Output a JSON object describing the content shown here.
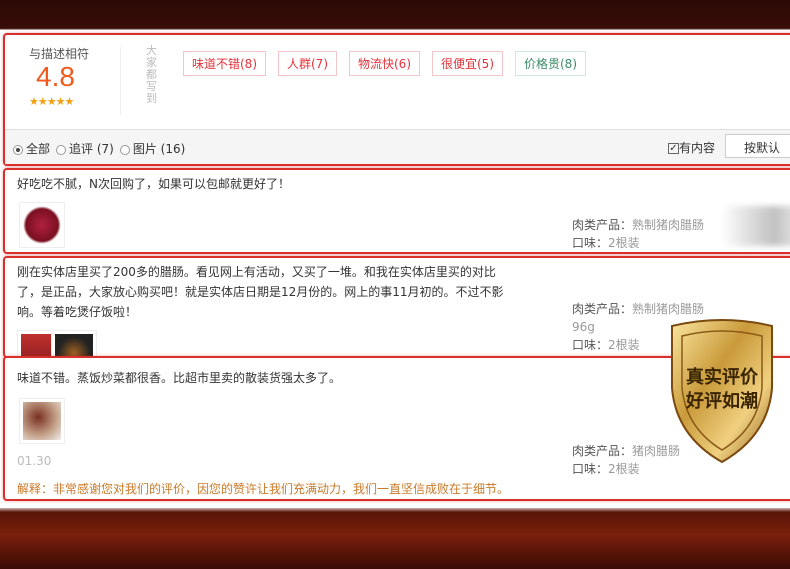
{
  "summary": {
    "score_label": "与描述相符",
    "score": "4.8",
    "stars": "★★★★★",
    "side_text": "大家都写到",
    "tags": [
      {
        "label": "味道不错(8)"
      },
      {
        "label": "人群(7)"
      },
      {
        "label": "物流快(6)"
      },
      {
        "label": "很便宜(5)"
      },
      {
        "label": "价格贵(8)"
      }
    ]
  },
  "filters": {
    "all": "全部",
    "append": "追评 (7)",
    "pictures": "图片 (16)",
    "has_content": "有内容",
    "sort": "按默认"
  },
  "reviews": [
    {
      "text": "好吃吃不腻，N次回购了，如果可以包邮就更好了！",
      "product_label": "肉类产品：",
      "product": "熟制猪肉腊肠",
      "taste_label": "口味：",
      "taste": "2根装"
    },
    {
      "text": "刚在实体店里买了200多的腊肠。看见网上有活动，又买了一堆。和我在实体店里买的对比了，是正品，大家放心购买吧！就是实体店日期是12月份的。网上的事11月初的。不过不影响。等着吃煲仔饭啦！",
      "product_label": "肉类产品：",
      "product": "熟制猪肉腊肠",
      "weight": "96g",
      "taste_label": "口味：",
      "taste": "2根装"
    },
    {
      "text": "味道不错。蒸饭炒菜都很香。比超市里卖的散装货强太多了。",
      "date": "01.30",
      "product_label": "肉类产品：",
      "product": "猪肉腊肠",
      "taste_label": "口味：",
      "taste": "2根装",
      "reply": "解释：非常感谢您对我们的评价，因您的赞许让我们充满动力，我们一直坚信成败在于细节。"
    }
  ],
  "badge": {
    "line1": "真实评价",
    "line2": "好评如潮"
  },
  "colors": {
    "accent": "#d9302c",
    "score": "#f05a1a",
    "gold": "#c99a3a"
  }
}
